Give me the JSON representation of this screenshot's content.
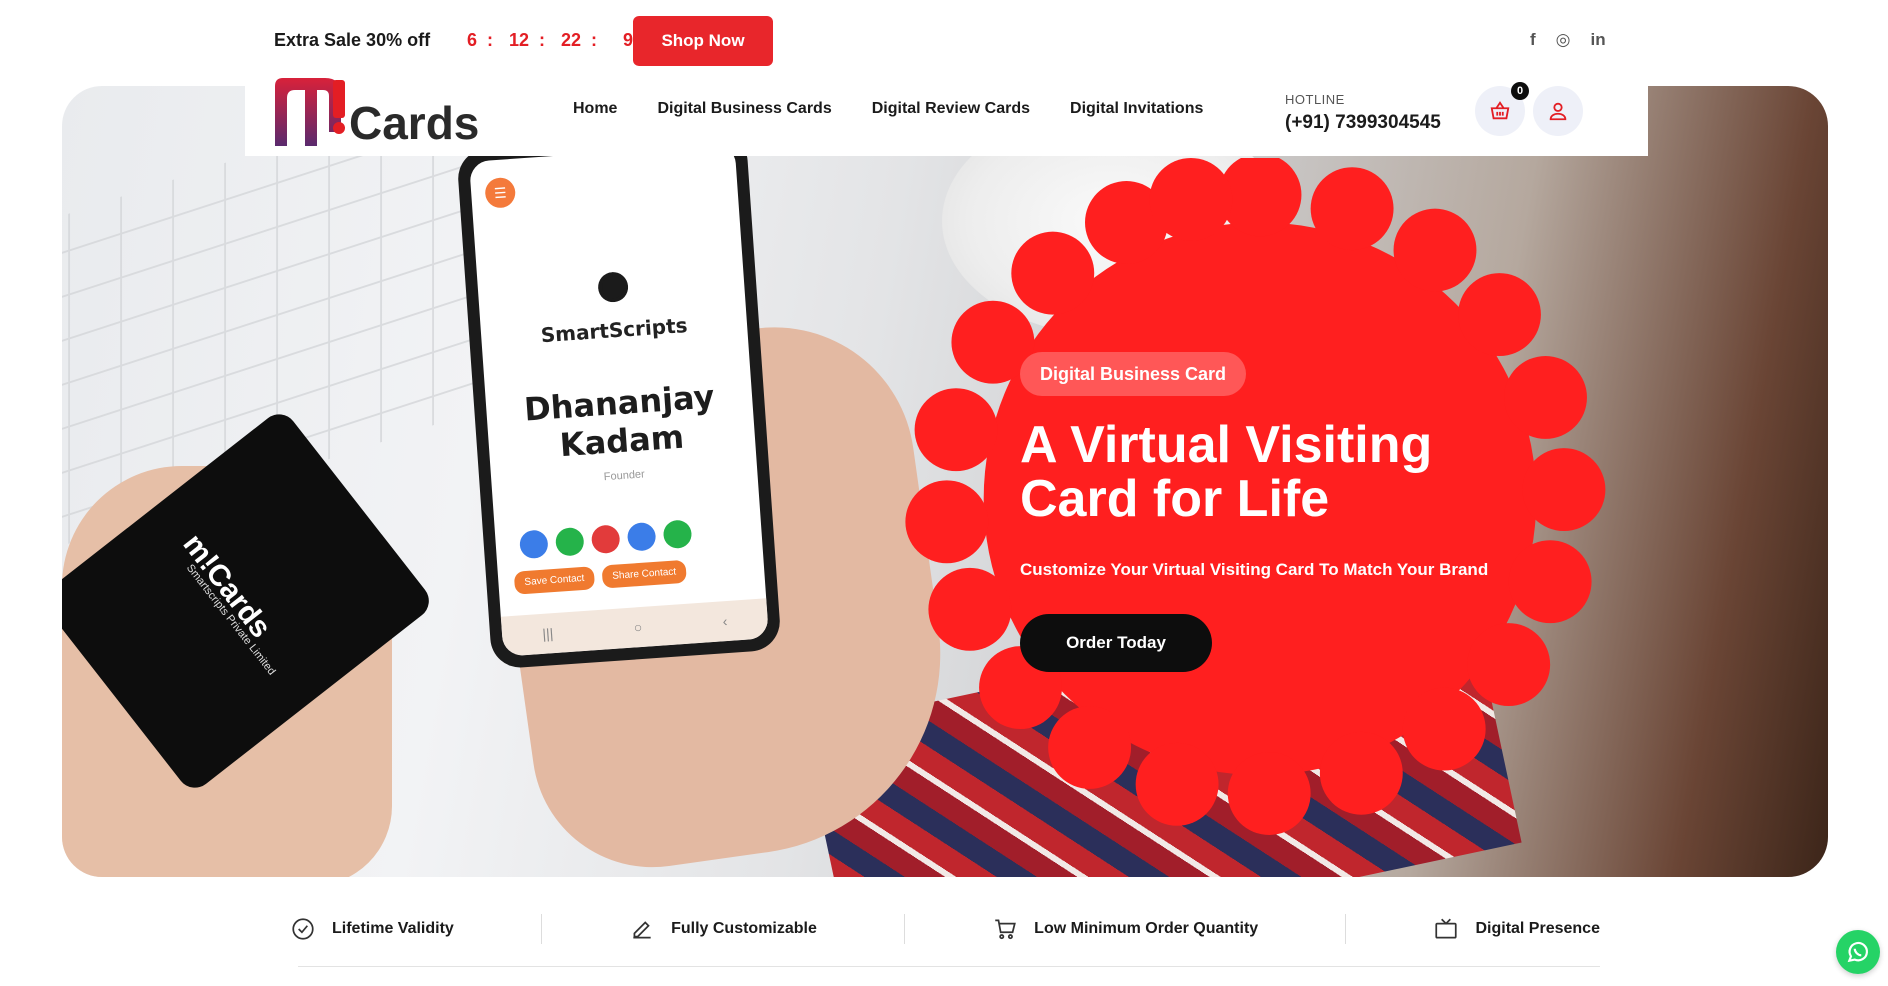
{
  "topbar": {
    "sale_text": "Extra Sale 30% off",
    "countdown": {
      "days": "6",
      "hours": "12",
      "minutes": "22",
      "seconds": "9",
      "separator": ":"
    },
    "shop_button": "Shop Now",
    "socials": [
      "facebook-icon",
      "instagram-icon",
      "linkedin-icon"
    ],
    "social_glyphs": {
      "facebook": "f",
      "instagram": "◎",
      "linkedin": "in"
    }
  },
  "header": {
    "logo_text": "Cards",
    "nav": [
      "Home",
      "Digital Business Cards",
      "Digital Review Cards",
      "Digital Invitations"
    ],
    "hotline_label": "HOTLINE",
    "hotline_number": "(+91) 7399304545",
    "cart_count": "0"
  },
  "hero": {
    "pill": "Digital Business Card",
    "title": "A Virtual Visiting Card for Life",
    "subtitle": "Customize Your Virtual Visiting Card To Match Your Brand",
    "cta": "Order Today",
    "phone": {
      "company": "SmartScripts",
      "person": "Dhananjay Kadam",
      "role": "Founder",
      "save_contact": "Save Contact",
      "share_contact": "Share Contact"
    },
    "card": {
      "logo": "m!Cards",
      "company": "Smartscripts Private Limited"
    }
  },
  "features": [
    {
      "icon": "check-badge-icon",
      "label": "Lifetime Validity"
    },
    {
      "icon": "edit-icon",
      "label": "Fully Customizable"
    },
    {
      "icon": "cart-icon",
      "label": "Low Minimum Order Quantity"
    },
    {
      "icon": "tv-icon",
      "label": "Digital Presence"
    }
  ],
  "colors": {
    "brand_red": "#e8262b",
    "badge_red": "#ff1f1f",
    "dark": "#0d0d0d",
    "logo_gradient_start": "#d8213a",
    "logo_gradient_end": "#5a2a6e"
  }
}
